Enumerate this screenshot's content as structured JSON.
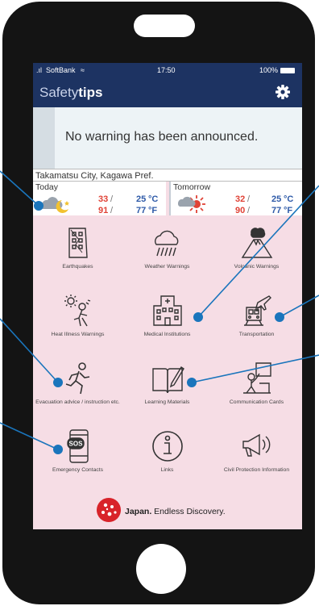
{
  "status_bar": {
    "carrier": "SoftBank",
    "time": "17:50",
    "battery": "100%"
  },
  "header": {
    "title_light": "Safety",
    "title_bold": "tips",
    "settings_icon": "gear-icon"
  },
  "warning": {
    "message": "No warning has been announced."
  },
  "location": {
    "name": "Takamatsu City, Kagawa Pref."
  },
  "weather": {
    "today": {
      "label": "Today",
      "icon": "cloud-moon-icon",
      "high_c": "33",
      "low_c": "25",
      "unit_c": "°C",
      "high_f": "91",
      "low_f": "77",
      "unit_f": "°F"
    },
    "tomorrow": {
      "label": "Tomorrow",
      "icon": "cloud-sun-icon",
      "high_c": "32",
      "low_c": "25",
      "unit_c": "°C",
      "high_f": "90",
      "low_f": "77",
      "unit_f": "°F"
    }
  },
  "menu": [
    {
      "label": "Earthquakes",
      "icon": "earthquake-building-icon"
    },
    {
      "label": "Weather Warnings",
      "icon": "rain-cloud-icon"
    },
    {
      "label": "Volcanic Warnings",
      "icon": "volcano-icon"
    },
    {
      "label": "Heat Illness Warnings",
      "icon": "heat-illness-icon"
    },
    {
      "label": "Medical Institutions",
      "icon": "hospital-icon"
    },
    {
      "label": "Transportation",
      "icon": "train-plane-icon"
    },
    {
      "label": "Evacuation advice / instruction etc.",
      "icon": "evacuation-runner-icon"
    },
    {
      "label": "Learning Materials",
      "icon": "book-pencil-icon"
    },
    {
      "label": "Communication Cards",
      "icon": "communication-card-icon"
    },
    {
      "label": "Emergency Contacts",
      "icon": "sos-phone-icon"
    },
    {
      "label": "Links",
      "icon": "info-icon"
    },
    {
      "label": "Civil Protection Information",
      "icon": "megaphone-icon"
    }
  ],
  "footer": {
    "brand_bold": "Japan.",
    "brand_rest": " Endless Discovery.",
    "logo_icon": "cherry-blossom-logo-icon"
  },
  "colors": {
    "nav": "#1d3362",
    "menu_bg": "#f6dde5",
    "callout": "#1a75bc",
    "temp_high": "#e04236",
    "temp_low": "#2e5aa8"
  }
}
